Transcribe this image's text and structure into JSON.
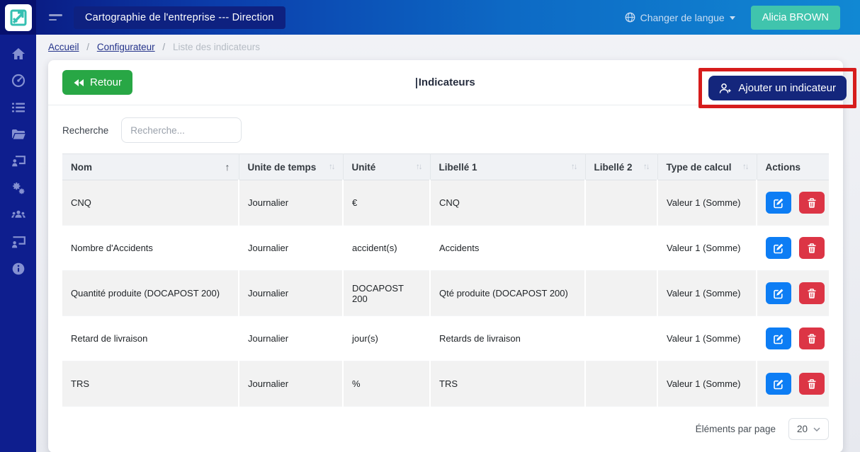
{
  "topbar": {
    "app_title": "Cartographie de l'entreprise --- Direction",
    "language_label": "Changer de langue",
    "user_name": "Alicia BROWN"
  },
  "sidebar": {
    "items": [
      {
        "name": "home",
        "active": false
      },
      {
        "name": "dashboard",
        "active": false
      },
      {
        "name": "list",
        "active": false
      },
      {
        "name": "folder",
        "active": false
      },
      {
        "name": "training",
        "active": false
      },
      {
        "name": "settings",
        "active": true
      },
      {
        "name": "users",
        "active": false
      },
      {
        "name": "presentation",
        "active": false
      },
      {
        "name": "info",
        "active": false
      }
    ]
  },
  "breadcrumb": {
    "items": [
      {
        "label": "Accueil",
        "link": true
      },
      {
        "label": "Configurateur",
        "link": true
      },
      {
        "label": "Liste des indicateurs",
        "link": false
      }
    ]
  },
  "page": {
    "back_label": "Retour",
    "title": "Indicateurs",
    "add_button_label": "Ajouter un indicateur",
    "search_label": "Recherche",
    "search_placeholder": "Recherche...",
    "search_value": "",
    "per_page_label": "Éléments par page",
    "per_page_value": "20"
  },
  "table": {
    "columns": [
      {
        "key": "nom",
        "label": "Nom",
        "sort": "asc"
      },
      {
        "key": "unite_de_temps",
        "label": "Unite de temps",
        "sort": "both"
      },
      {
        "key": "unite",
        "label": "Unité",
        "sort": "both"
      },
      {
        "key": "libelle1",
        "label": "Libellé 1",
        "sort": "both"
      },
      {
        "key": "libelle2",
        "label": "Libellé 2",
        "sort": "both"
      },
      {
        "key": "type_de_calcul",
        "label": "Type de calcul",
        "sort": "both"
      },
      {
        "key": "actions",
        "label": "Actions",
        "sort": "none"
      }
    ],
    "rows": [
      {
        "nom": "CNQ",
        "unite_de_temps": "Journalier",
        "unite": "€",
        "libelle1": "CNQ",
        "libelle2": "",
        "type_de_calcul": "Valeur 1 (Somme)"
      },
      {
        "nom": "Nombre d'Accidents",
        "unite_de_temps": "Journalier",
        "unite": "accident(s)",
        "libelle1": "Accidents",
        "libelle2": "",
        "type_de_calcul": "Valeur 1 (Somme)"
      },
      {
        "nom": "Quantité produite (DOCAPOST 200)",
        "unite_de_temps": "Journalier",
        "unite": "DOCAPOST 200",
        "libelle1": "Qté produite (DOCAPOST 200)",
        "libelle2": "",
        "type_de_calcul": "Valeur 1 (Somme)"
      },
      {
        "nom": "Retard de livraison",
        "unite_de_temps": "Journalier",
        "unite": "jour(s)",
        "libelle1": "Retards de livraison",
        "libelle2": "",
        "type_de_calcul": "Valeur 1 (Somme)"
      },
      {
        "nom": "TRS",
        "unite_de_temps": "Journalier",
        "unite": "%",
        "libelle1": "TRS",
        "libelle2": "",
        "type_de_calcul": "Valeur 1 (Somme)"
      }
    ]
  },
  "colors": {
    "topbar_gradient_start": "#0a1d85",
    "topbar_gradient_end": "#1188d3",
    "sidebar": "#0e1e8e",
    "sidebar_active": "#081261",
    "teal_accent": "#40c4ad",
    "green_button": "#28a745",
    "navy_button": "#14267c",
    "edit_blue": "#0d7df4",
    "delete_red": "#dc3545",
    "annotation_red": "#d61c1c",
    "row_stripe": "#f2f2f2"
  }
}
